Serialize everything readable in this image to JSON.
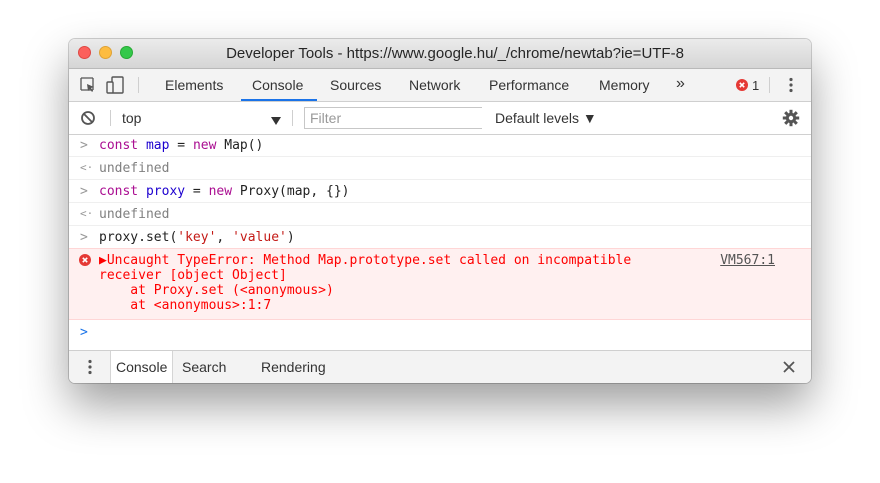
{
  "window": {
    "title": "Developer Tools - https://www.google.hu/_/chrome/newtab?ie=UTF-8"
  },
  "tabs": [
    "Elements",
    "Console",
    "Sources",
    "Network",
    "Performance",
    "Memory"
  ],
  "overflow_glyph": "»",
  "error_count": "1",
  "toolbar": {
    "context": "top",
    "filter_placeholder": "Filter",
    "levels": "Default levels ▼"
  },
  "console": {
    "entries": [
      {
        "kind": "input",
        "code": [
          [
            "kw",
            "const "
          ],
          [
            "var",
            "map"
          ],
          [
            "plain",
            " = "
          ],
          [
            "kw",
            "new "
          ],
          [
            "plain",
            "Map()"
          ]
        ]
      },
      {
        "kind": "result",
        "text": "undefined"
      },
      {
        "kind": "input",
        "code": [
          [
            "kw",
            "const "
          ],
          [
            "var",
            "proxy"
          ],
          [
            "plain",
            " = "
          ],
          [
            "kw",
            "new "
          ],
          [
            "plain",
            "Proxy(map, {})"
          ]
        ]
      },
      {
        "kind": "result",
        "text": "undefined"
      },
      {
        "kind": "input",
        "code": [
          [
            "plain",
            "proxy.set("
          ],
          [
            "str",
            "'key'"
          ],
          [
            "plain",
            ", "
          ],
          [
            "str",
            "'value'"
          ],
          [
            "plain",
            ")"
          ]
        ]
      }
    ],
    "error": {
      "lines": [
        "▶Uncaught TypeError: Method Map.prototype.set called on incompatible",
        "receiver [object Object]",
        "    at Proxy.set (<anonymous>)",
        "    at <anonymous>:1:7"
      ],
      "link": "VM567:1"
    }
  },
  "drawer": {
    "tabs": [
      "Console",
      "Search",
      "Rendering"
    ]
  },
  "colors": {
    "accent": "#1a73e8",
    "error": "#ff0000",
    "error_bg": "#fff0f0",
    "keyword": "#aa0d91",
    "variable": "#1c00cf",
    "string": "#c41a16"
  },
  "icons": [
    "inspect-icon",
    "device-icon",
    "overflow-icon",
    "error-icon",
    "kebab-menu-icon",
    "clear-console-icon",
    "dropdown-arrow-icon",
    "gear-icon",
    "close-icon"
  ]
}
